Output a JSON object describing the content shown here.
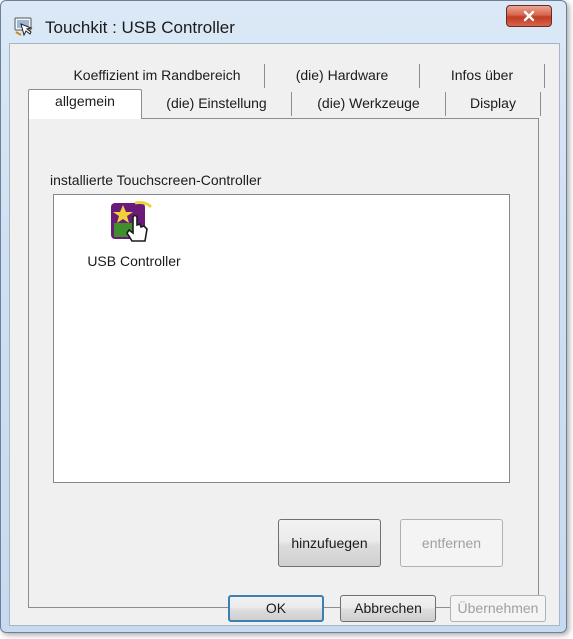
{
  "window": {
    "title": "Touchkit : USB Controller",
    "close_label": "x"
  },
  "tabs": {
    "row_back": [
      {
        "label": "Koeffizient im Randbereich"
      },
      {
        "label": "(die) Hardware"
      },
      {
        "label": "Infos über"
      }
    ],
    "row_front": [
      {
        "label": "allgemein",
        "selected": true
      },
      {
        "label": "(die) Einstellung"
      },
      {
        "label": "(die) Werkzeuge"
      },
      {
        "label": "Display"
      }
    ]
  },
  "panel": {
    "group_label": "installierte Touchscreen-Controller",
    "controllers": [
      {
        "label": "USB Controller",
        "icon": "touch-controller-icon"
      }
    ],
    "add_button": "hinzufuegen",
    "remove_button": "entfernen"
  },
  "footer": {
    "ok": "OK",
    "cancel": "Abbrechen",
    "apply": "Übernehmen"
  },
  "colors": {
    "title_gradient_top": "#dbe9f7",
    "close_red": "#c13b22",
    "default_button_border": "#3c7fb1",
    "disabled_text": "#a0a0a0"
  }
}
